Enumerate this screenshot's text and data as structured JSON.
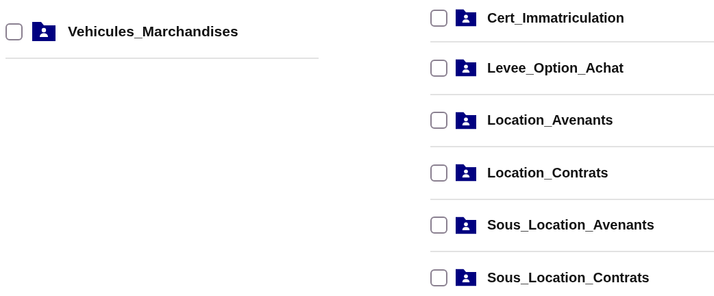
{
  "left_folders": [
    {
      "name": "Vehicules_Marchandises",
      "checked": false
    }
  ],
  "right_folders": [
    {
      "name": "Cert_Immatriculation",
      "checked": false
    },
    {
      "name": "Levee_Option_Achat",
      "checked": false
    },
    {
      "name": "Location_Avenants",
      "checked": false
    },
    {
      "name": "Location_Contrats",
      "checked": false
    },
    {
      "name": "Sous_Location_Avenants",
      "checked": false
    },
    {
      "name": "Sous_Location_Contrats",
      "checked": false
    }
  ]
}
